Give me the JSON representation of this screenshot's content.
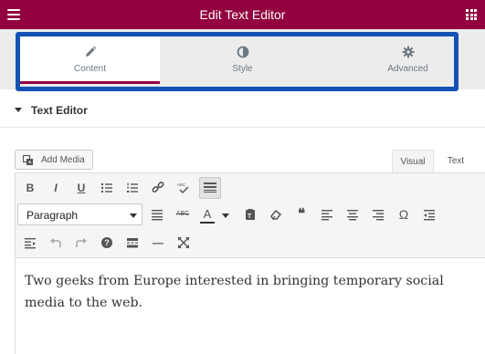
{
  "header": {
    "title": "Edit Text Editor",
    "menu_icon": "hamburger-icon",
    "apps_icon": "grid-icon"
  },
  "colors": {
    "brand": "#93003f",
    "highlight": "#1452b5"
  },
  "tabs": [
    {
      "label": "Content",
      "icon": "pencil-icon",
      "active": true
    },
    {
      "label": "Style",
      "icon": "half-circle-icon",
      "active": false
    },
    {
      "label": "Advanced",
      "icon": "gear-icon",
      "active": false
    }
  ],
  "section": {
    "label": "Text Editor"
  },
  "editor": {
    "add_media_label": "Add Media",
    "modes": {
      "visual": "Visual",
      "text": "Text",
      "active": "Visual"
    },
    "format_select": {
      "value": "Paragraph"
    },
    "toolbar_row1": [
      "bold-icon",
      "italic-icon",
      "underline-icon",
      "bullet-list-icon",
      "numbered-list-icon",
      "link-icon",
      "spellcheck-icon",
      "toolbar-toggle-icon"
    ],
    "toolbar_row2": [
      "align-justify-icon",
      "strikethrough-icon",
      "text-color-icon",
      "paste-text-icon",
      "clear-format-icon",
      "blockquote-icon",
      "align-left-icon",
      "align-center-icon",
      "align-right-icon",
      "omega-icon",
      "outdent-icon"
    ],
    "toolbar_row3": [
      "indent-icon",
      "undo-icon",
      "redo-icon",
      "help-icon",
      "read-more-icon",
      "horizontal-line-icon",
      "fullscreen-icon"
    ],
    "labels": {
      "bold": "B",
      "italic": "I",
      "underline": "U",
      "strike": "ABC",
      "color": "A",
      "omega": "Ω",
      "quote": "❝",
      "help": "?",
      "hr": "—"
    },
    "content": "Two geeks from Europe interested in bringing temporary social media to the web."
  }
}
